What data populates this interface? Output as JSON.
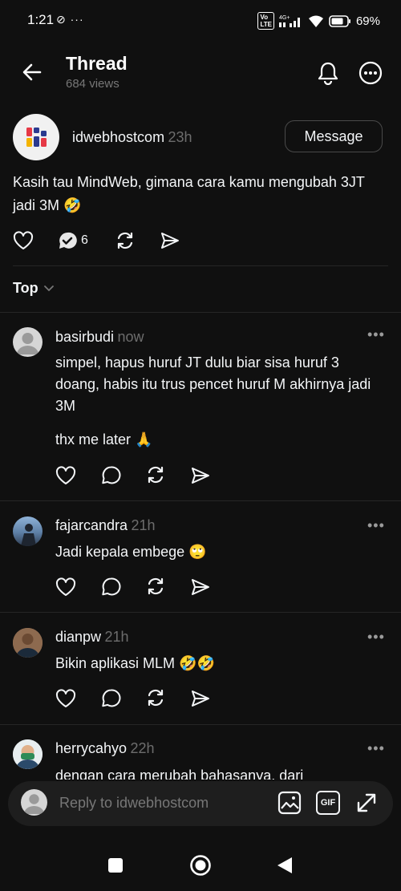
{
  "status_bar": {
    "time": "1:21",
    "left_icons": "⊘ ···",
    "network": "4G+",
    "battery": "69%"
  },
  "header": {
    "back_icon": "arrow-left-icon",
    "title": "Thread",
    "views": "684 views",
    "bell_icon": "bell-icon",
    "more_icon": "more-circle-icon"
  },
  "post": {
    "username": "idwebhostcom",
    "time": "23h",
    "message_button": "Message",
    "text": "Kasih tau MindWeb, gimana cara kamu mengubah 3JT jadi 3M 🤣",
    "reply_count": "6"
  },
  "sort": {
    "label": "Top"
  },
  "replies": [
    {
      "username": "basirbudi",
      "time": "now",
      "text": "simpel, hapus huruf JT dulu biar sisa huruf 3 doang, habis itu trus pencet huruf M  akhirnya jadi 3M",
      "text2": "thx me later 🙏"
    },
    {
      "username": "fajarcandra",
      "time": "21h",
      "text": "Jadi kepala embege 🙄"
    },
    {
      "username": "dianpw",
      "time": "21h",
      "text": "Bikin aplikasi MLM 🤣🤣"
    },
    {
      "username": "herrycahyo",
      "time": "22h",
      "text": "dengan cara merubah bahasanya, dari"
    }
  ],
  "composer": {
    "placeholder": "Reply to idwebhostcom",
    "gif_label": "GIF"
  },
  "colors": {
    "background": "#101010",
    "text": "#f3f5f7",
    "muted": "#777777",
    "divider": "#262626"
  }
}
